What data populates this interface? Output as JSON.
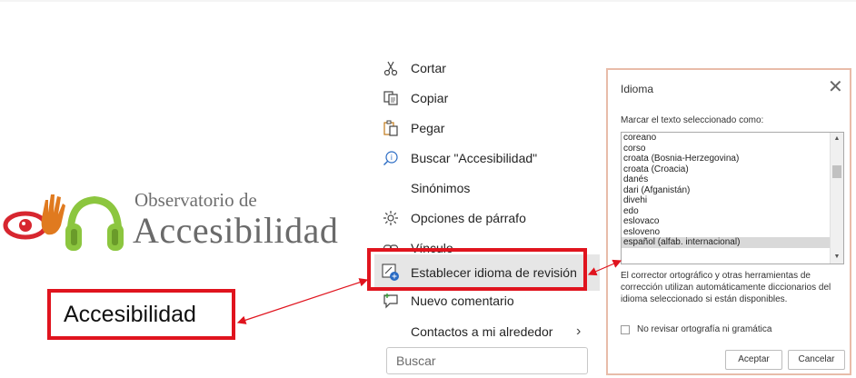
{
  "logo": {
    "line1": "Observatorio de",
    "line2": "Accesibilidad"
  },
  "callout": {
    "text": "Accesibilidad"
  },
  "context_menu": {
    "items": [
      {
        "label": "Cortar",
        "icon": "scissors-icon"
      },
      {
        "label": "Copiar",
        "icon": "copy-icon"
      },
      {
        "label": "Pegar",
        "icon": "paste-icon"
      },
      {
        "label": "Buscar \"Accesibilidad\"",
        "icon": "search-icon"
      },
      {
        "label": "Sinónimos",
        "icon": ""
      },
      {
        "label": "Opciones de párrafo",
        "icon": "paragraph-options-icon"
      },
      {
        "label": "Vínculo",
        "icon": "link-icon"
      },
      {
        "label": "Establecer idioma de revisión",
        "icon": "language-icon"
      },
      {
        "label": "Nuevo comentario",
        "icon": "comment-icon"
      },
      {
        "label": "Contactos a mi alrededor",
        "icon": ""
      }
    ],
    "chevron": "›",
    "search_placeholder": "Buscar"
  },
  "dialog": {
    "title": "Idioma",
    "close": "✕",
    "prompt": "Marcar el texto seleccionado como:",
    "languages": [
      "coreano",
      "corso",
      "croata (Bosnia-Herzegovina)",
      "croata (Croacia)",
      "danés",
      "dari (Afganistán)",
      "divehi",
      "edo",
      "eslovaco",
      "esloveno",
      "español (alfab. internacional)"
    ],
    "selected_language": "español (alfab. internacional)",
    "description": "El corrector ortográfico y otras herramientas de corrección utilizan automáticamente diccionarios del idioma seleccionado si están disponibles.",
    "checkbox_label": "No revisar ortografía ni gramática",
    "ok_label": "Aceptar",
    "cancel_label": "Cancelar"
  },
  "colors": {
    "highlight_red": "#e0141e",
    "dialog_border": "#e8bca9",
    "logo_orange": "#e07a1f",
    "logo_green": "#8cc63f",
    "logo_red": "#d7262f"
  }
}
